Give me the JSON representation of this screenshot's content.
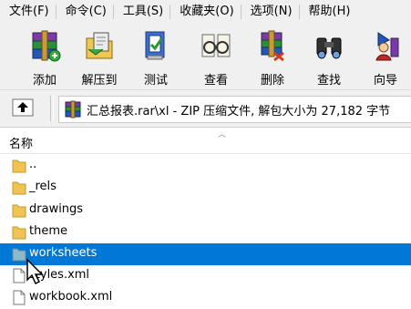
{
  "menu": {
    "items": [
      {
        "label": "文件(F)"
      },
      {
        "label": "命令(C)"
      },
      {
        "label": "工具(S)"
      },
      {
        "label": "收藏夹(O)"
      },
      {
        "label": "选项(N)"
      },
      {
        "label": "帮助(H)"
      }
    ]
  },
  "toolbar": {
    "buttons": [
      {
        "label": "添加",
        "icon": "add-archive-icon"
      },
      {
        "label": "解压到",
        "icon": "extract-to-icon"
      },
      {
        "label": "测试",
        "icon": "test-icon"
      },
      {
        "label": "查看",
        "icon": "view-icon"
      },
      {
        "label": "删除",
        "icon": "delete-icon"
      },
      {
        "label": "查找",
        "icon": "find-icon"
      },
      {
        "label": "向导",
        "icon": "wizard-icon"
      }
    ]
  },
  "address": {
    "path_text": "汇总报表.rar\\xl - ZIP 压缩文件, 解包大小为 27,182 字节"
  },
  "list": {
    "column_name": "名称",
    "rows": [
      {
        "name": "..",
        "type": "folder"
      },
      {
        "name": "_rels",
        "type": "folder"
      },
      {
        "name": "drawings",
        "type": "folder"
      },
      {
        "name": "theme",
        "type": "folder"
      },
      {
        "name": "worksheets",
        "type": "folder-selected"
      },
      {
        "name": "styles.xml",
        "type": "file"
      },
      {
        "name": "workbook.xml",
        "type": "file"
      }
    ]
  },
  "colors": {
    "selection": "#0078d7",
    "folder": "#f0c454"
  }
}
